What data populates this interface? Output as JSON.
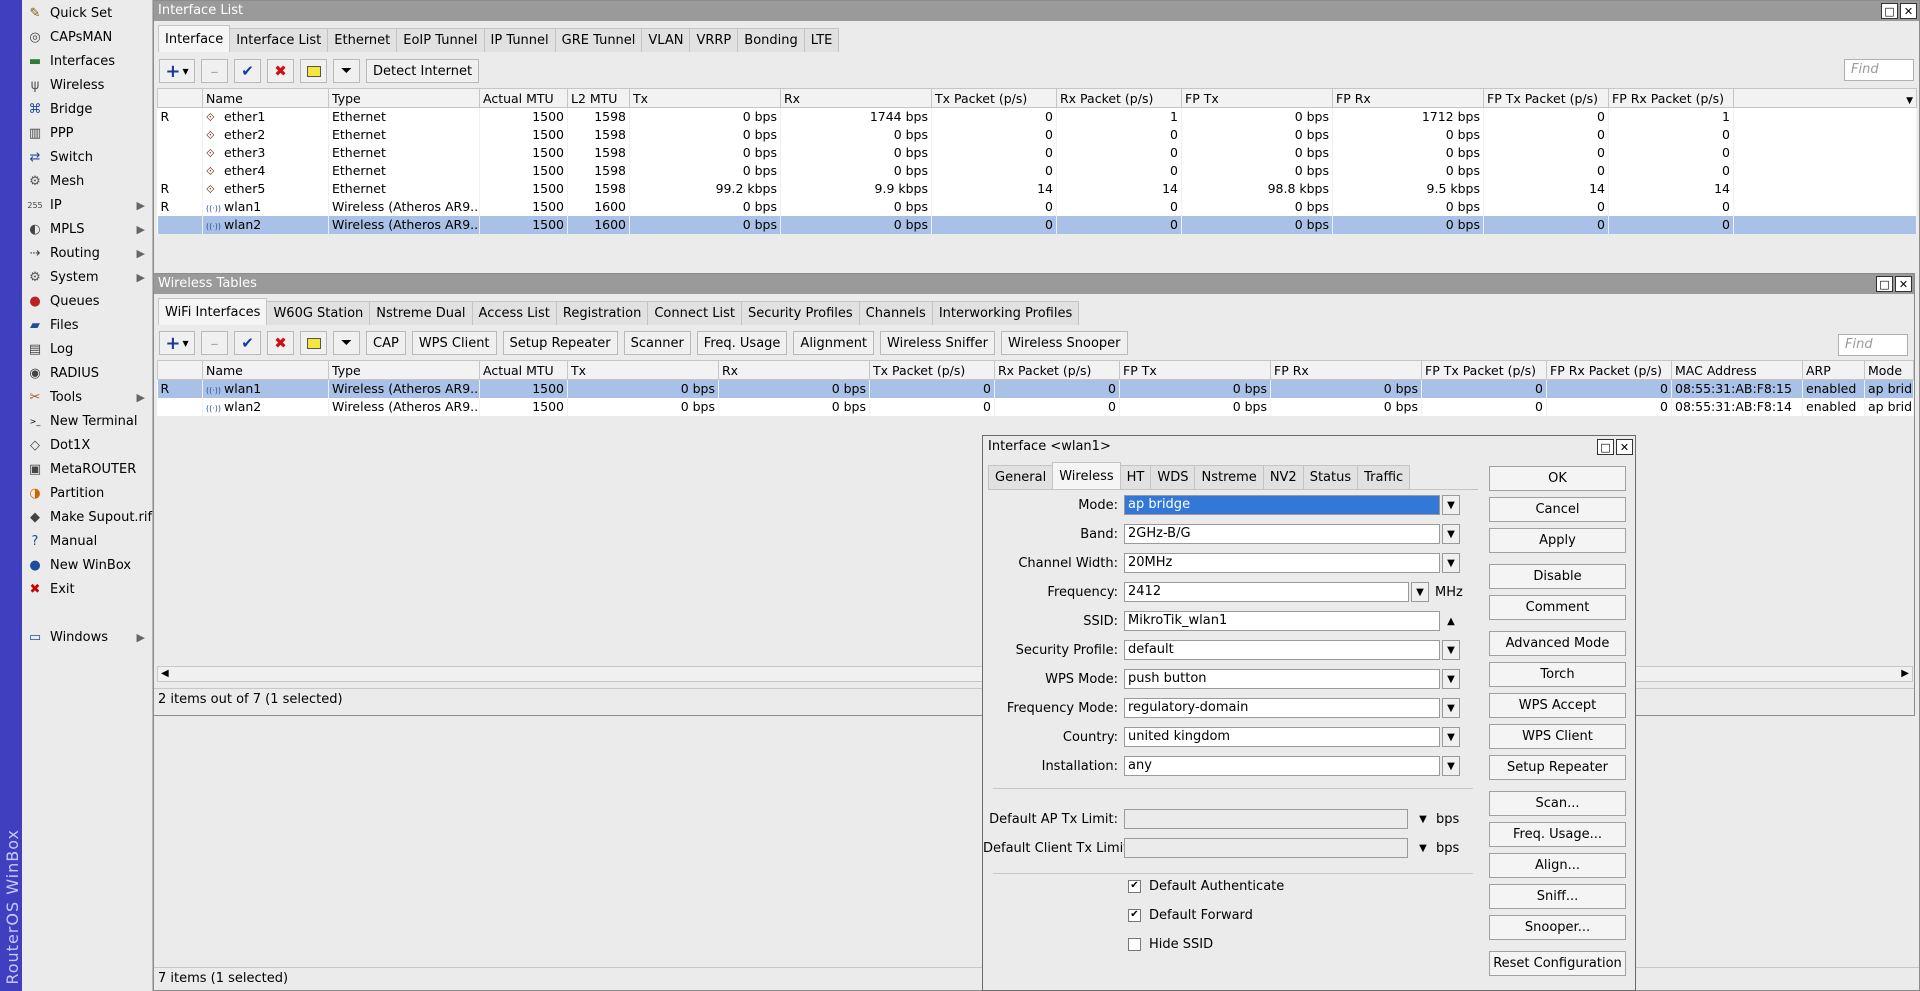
{
  "app": {
    "strip_text": "RouterOS WinBox"
  },
  "sidebar": {
    "items": [
      {
        "label": "Quick Set",
        "icon": "quickset-icon",
        "arrow": false
      },
      {
        "label": "CAPsMAN",
        "icon": "capsman-icon",
        "arrow": false
      },
      {
        "label": "Interfaces",
        "icon": "interfaces-icon",
        "arrow": false
      },
      {
        "label": "Wireless",
        "icon": "wireless-icon",
        "arrow": false
      },
      {
        "label": "Bridge",
        "icon": "bridge-icon",
        "arrow": false
      },
      {
        "label": "PPP",
        "icon": "ppp-icon",
        "arrow": false
      },
      {
        "label": "Switch",
        "icon": "switch-icon",
        "arrow": false
      },
      {
        "label": "Mesh",
        "icon": "mesh-icon",
        "arrow": false
      },
      {
        "label": "IP",
        "icon": "ip-icon",
        "arrow": true
      },
      {
        "label": "MPLS",
        "icon": "mpls-icon",
        "arrow": true
      },
      {
        "label": "Routing",
        "icon": "routing-icon",
        "arrow": true
      },
      {
        "label": "System",
        "icon": "system-icon",
        "arrow": true
      },
      {
        "label": "Queues",
        "icon": "queues-icon",
        "arrow": false
      },
      {
        "label": "Files",
        "icon": "files-icon",
        "arrow": false
      },
      {
        "label": "Log",
        "icon": "log-icon",
        "arrow": false
      },
      {
        "label": "RADIUS",
        "icon": "radius-icon",
        "arrow": false
      },
      {
        "label": "Tools",
        "icon": "tools-icon",
        "arrow": true
      },
      {
        "label": "New Terminal",
        "icon": "terminal-icon",
        "arrow": false
      },
      {
        "label": "Dot1X",
        "icon": "dot1x-icon",
        "arrow": false
      },
      {
        "label": "MetaROUTER",
        "icon": "metarouter-icon",
        "arrow": false
      },
      {
        "label": "Partition",
        "icon": "partition-icon",
        "arrow": false
      },
      {
        "label": "Make Supout.rif",
        "icon": "supout-icon",
        "arrow": false
      },
      {
        "label": "Manual",
        "icon": "manual-icon",
        "arrow": false
      },
      {
        "label": "New WinBox",
        "icon": "winbox-icon",
        "arrow": false
      },
      {
        "label": "Exit",
        "icon": "exit-icon",
        "arrow": false
      }
    ],
    "windows": {
      "label": "Windows",
      "icon": "windows-icon",
      "arrow": true
    }
  },
  "iface_window": {
    "title": "Interface List",
    "tabs": [
      "Interface",
      "Interface List",
      "Ethernet",
      "EoIP Tunnel",
      "IP Tunnel",
      "GRE Tunnel",
      "VLAN",
      "VRRP",
      "Bonding",
      "LTE"
    ],
    "detect_label": "Detect Internet",
    "find_placeholder": "Find",
    "columns": [
      "",
      "Name",
      "Type",
      "Actual MTU",
      "L2 MTU",
      "Tx",
      "Rx",
      "Tx Packet (p/s)",
      "Rx Packet (p/s)",
      "FP Tx",
      "FP Rx",
      "FP Tx Packet (p/s)",
      "FP Rx Packet (p/s)"
    ],
    "rows": [
      [
        "R",
        "ether1",
        "Ethernet",
        "1500",
        "1598",
        "0 bps",
        "1744 bps",
        "0",
        "1",
        "0 bps",
        "1712 bps",
        "0",
        "1"
      ],
      [
        "",
        "ether2",
        "Ethernet",
        "1500",
        "1598",
        "0 bps",
        "0 bps",
        "0",
        "0",
        "0 bps",
        "0 bps",
        "0",
        "0"
      ],
      [
        "",
        "ether3",
        "Ethernet",
        "1500",
        "1598",
        "0 bps",
        "0 bps",
        "0",
        "0",
        "0 bps",
        "0 bps",
        "0",
        "0"
      ],
      [
        "",
        "ether4",
        "Ethernet",
        "1500",
        "1598",
        "0 bps",
        "0 bps",
        "0",
        "0",
        "0 bps",
        "0 bps",
        "0",
        "0"
      ],
      [
        "R",
        "ether5",
        "Ethernet",
        "1500",
        "1598",
        "99.2 kbps",
        "9.9 kbps",
        "14",
        "14",
        "98.8 kbps",
        "9.5 kbps",
        "14",
        "14"
      ],
      [
        "R",
        "wlan1",
        "Wireless (Atheros AR9...",
        "1500",
        "1600",
        "0 bps",
        "0 bps",
        "0",
        "0",
        "0 bps",
        "0 bps",
        "0",
        "0"
      ],
      [
        "",
        "wlan2",
        "Wireless (Atheros AR9...",
        "1500",
        "1600",
        "0 bps",
        "0 bps",
        "0",
        "0",
        "0 bps",
        "0 bps",
        "0",
        "0"
      ]
    ],
    "row_kinds": [
      "eth",
      "eth",
      "eth",
      "eth",
      "eth",
      "wl",
      "wl"
    ],
    "selected_row": 6,
    "status": "7 items (1 selected)"
  },
  "wl_window": {
    "title": "Wireless Tables",
    "tabs": [
      "WiFi Interfaces",
      "W60G Station",
      "Nstreme Dual",
      "Access List",
      "Registration",
      "Connect List",
      "Security Profiles",
      "Channels",
      "Interworking Profiles"
    ],
    "toolbar_buttons": [
      "CAP",
      "WPS Client",
      "Setup Repeater",
      "Scanner",
      "Freq. Usage",
      "Alignment",
      "Wireless Sniffer",
      "Wireless Snooper"
    ],
    "find_placeholder": "Find",
    "columns": [
      "",
      "Name",
      "Type",
      "Actual MTU",
      "Tx",
      "Rx",
      "Tx Packet (p/s)",
      "Rx Packet (p/s)",
      "FP Tx",
      "FP Rx",
      "FP Tx Packet (p/s)",
      "FP Rx Packet (p/s)",
      "MAC Address",
      "ARP",
      "Mode"
    ],
    "rows": [
      [
        "R",
        "wlan1",
        "Wireless (Atheros AR9...",
        "1500",
        "0 bps",
        "0 bps",
        "0",
        "0",
        "0 bps",
        "0 bps",
        "0",
        "0",
        "08:55:31:AB:F8:15",
        "enabled",
        "ap brid..."
      ],
      [
        "",
        "wlan2",
        "Wireless (Atheros AR9...",
        "1500",
        "0 bps",
        "0 bps",
        "0",
        "0",
        "0 bps",
        "0 bps",
        "0",
        "0",
        "08:55:31:AB:F8:14",
        "enabled",
        "ap brid..."
      ]
    ],
    "selected_row": 0,
    "status": "2 items out of 7 (1 selected)"
  },
  "dialog": {
    "title": "Interface <wlan1>",
    "tabs": [
      "General",
      "Wireless",
      "HT",
      "WDS",
      "Nstreme",
      "NV2",
      "Status",
      "Traffic"
    ],
    "active_tab": 1,
    "fields": [
      {
        "label": "Mode:",
        "value": "ap bridge",
        "selected": true,
        "unit": ""
      },
      {
        "label": "Band:",
        "value": "2GHz-B/G",
        "unit": ""
      },
      {
        "label": "Channel Width:",
        "value": "20MHz",
        "unit": ""
      },
      {
        "label": "Frequency:",
        "value": "2412",
        "unit": "MHz"
      },
      {
        "label": "SSID:",
        "value": "MikroTik_wlan1",
        "unit": ""
      },
      {
        "label": "Security Profile:",
        "value": "default",
        "unit": ""
      },
      {
        "label": "WPS Mode:",
        "value": "push button",
        "unit": ""
      },
      {
        "label": "Frequency Mode:",
        "value": "regulatory-domain",
        "unit": ""
      },
      {
        "label": "Country:",
        "value": "united kingdom",
        "unit": ""
      },
      {
        "label": "Installation:",
        "value": "any",
        "unit": ""
      }
    ],
    "limits": [
      {
        "label": "Default AP Tx Limit:",
        "value": "",
        "unit": "bps"
      },
      {
        "label": "Default Client Tx Limit:",
        "value": "",
        "unit": "bps"
      }
    ],
    "checks": [
      {
        "label": "Default Authenticate",
        "checked": true
      },
      {
        "label": "Default Forward",
        "checked": true
      },
      {
        "label": "Hide SSID",
        "checked": false
      }
    ],
    "buttons": [
      "OK",
      "Cancel",
      "Apply",
      "Disable",
      "Comment",
      "Advanced Mode",
      "Torch",
      "WPS Accept",
      "WPS Client",
      "Setup Repeater",
      "Scan...",
      "Freq. Usage...",
      "Align...",
      "Sniff...",
      "Snooper...",
      "Reset Configuration"
    ]
  }
}
